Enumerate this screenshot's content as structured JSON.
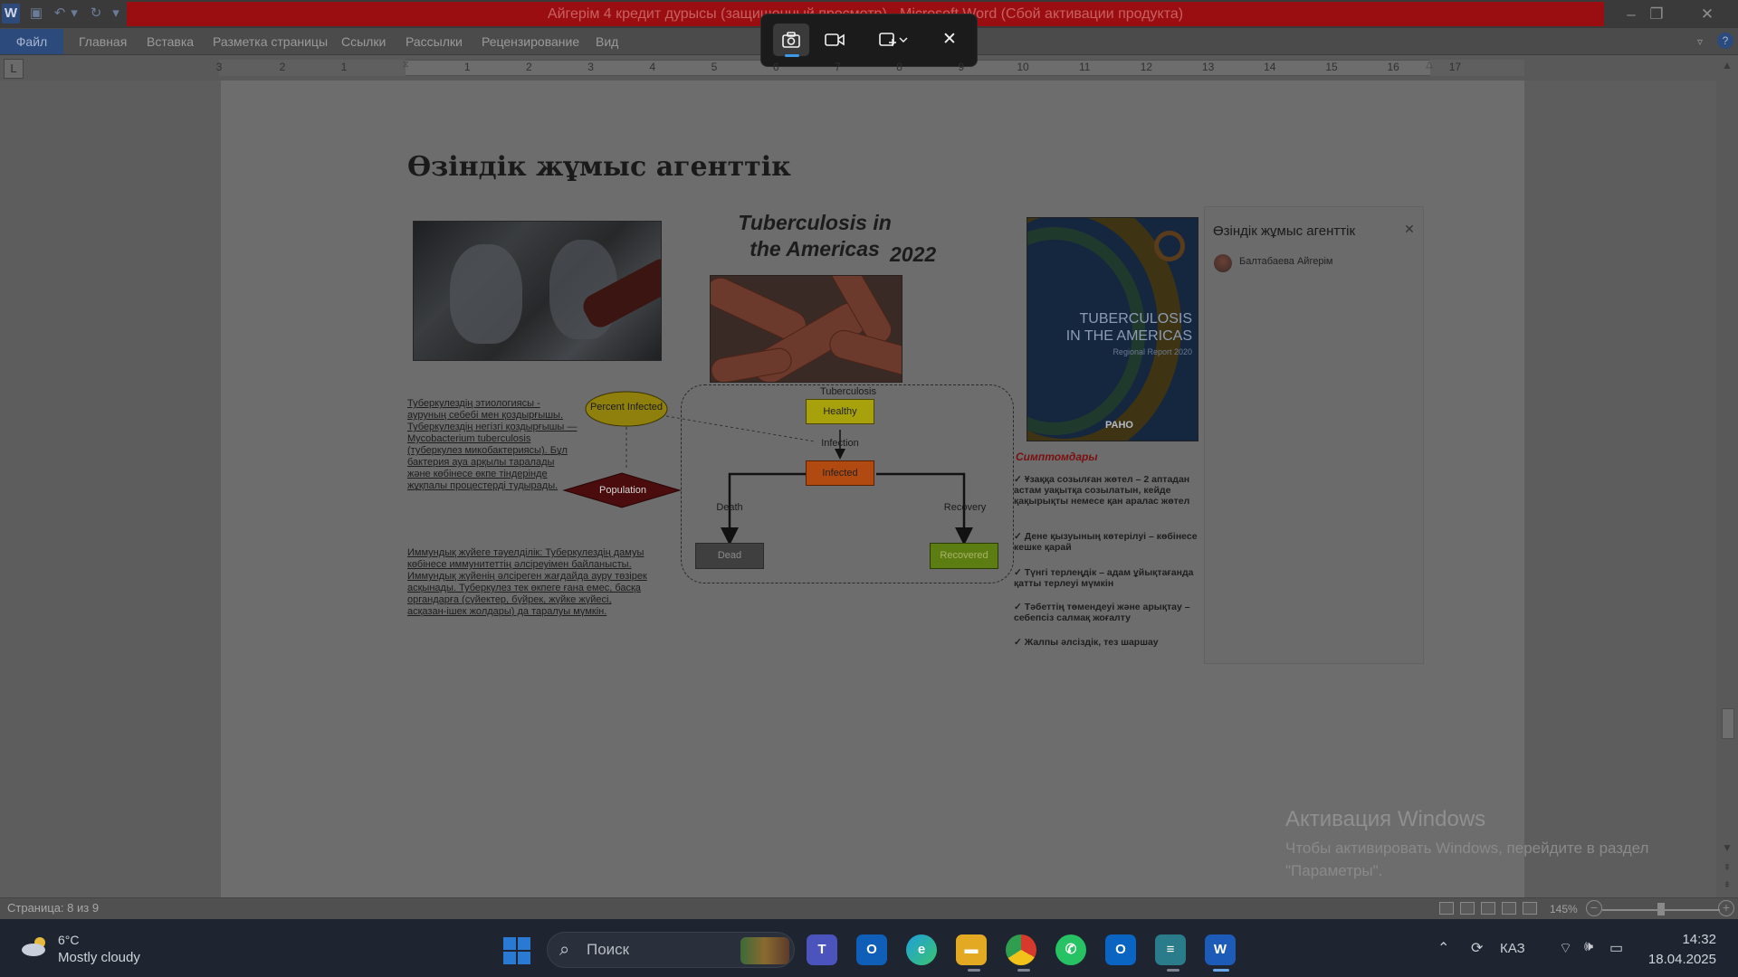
{
  "window": {
    "title": "Айгерім 4 кредит дурысы (защищенный просмотр) - Microsoft Word (Сбой активации продукта)",
    "app_icon": "W"
  },
  "ribbon": {
    "tabs": [
      "Файл",
      "Главная",
      "Вставка",
      "Разметка страницы",
      "Ссылки",
      "Рассылки",
      "Рецензирование",
      "Вид"
    ]
  },
  "ruler": {
    "left_numbers": [
      "3",
      "2",
      "1"
    ],
    "right_numbers": [
      "1",
      "2",
      "3",
      "4",
      "5",
      "6",
      "7",
      "8",
      "9",
      "10",
      "11",
      "12",
      "13",
      "14",
      "15",
      "16",
      "17"
    ]
  },
  "document": {
    "title": "Өзіндік жұмыс агенттік",
    "tb_title": "Tuberculosis in the Americas",
    "tb_year": "2022",
    "report_cover": {
      "title_line1": "TUBERCULOSIS",
      "title_line2": "IN THE AMERICAS",
      "subtitle": "Regional Report 2020",
      "logo": "PAHO"
    },
    "etiology_paragraph": "Туберкулездің этиологиясы - ауруның себебі мен қоздырғышы. Туберкулездің негізгі қоздырғышы — Mycobacterium tuberculosis (туберкулез микобактериясы). Бұл бактерия ауа арқылы таралады және көбінесе өкпе тіндерінде жұқпалы процестерді тудырады.",
    "immunity_paragraph": "Иммундық жүйеге тәуелділік: Туберкулездің дамуы көбінесе иммунитеттің әлсіреуімен байланысты. Иммундық жүйенің әлсіреген жағдайда ауру төзірек асқынады. Туберкулез тек өкпеге ғана емес, басқа органдарға (сүйектер, бүйрек, жүйке жүйесі, асқазан-ішек жолдары) да таралуы мүмкін.",
    "diagram": {
      "percent_infected": "Percent Infected",
      "population": "Population",
      "tuberculosis": "Tuberculosis",
      "healthy": "Healthy",
      "infection": "Infection",
      "infected": "Infected",
      "death": "Death",
      "recovery": "Recovery",
      "dead": "Dead",
      "recovered": "Recovered"
    },
    "symptoms": {
      "title": "Симптомдары",
      "items": [
        "✓ Ұзаққа созылған жөтел – 2 аптадан астам уақытқа созылатын, кейде қақырықты немесе қан аралас жөтел",
        "✓ Дене қызуының көтерілуі – көбінесе кешке қарай",
        "✓ Түнгі терлеңдік – адам ұйықтағанда қатты терлеуі мүмкін",
        "✓ Тәбеттің төмендеуі және арықтау – себепсіз салмақ жоғалту",
        "✓ Жалпы әлсіздік, тез шаршау"
      ]
    }
  },
  "side_pane": {
    "title": "Өзіндік жұмыс агенттік",
    "user": "Балтабаева Айгерім"
  },
  "capture_toolbar": {
    "buttons": [
      "camera-icon",
      "video-icon",
      "snip-mode-icon",
      "close-icon"
    ]
  },
  "watermark": {
    "title": "Активация Windows",
    "subtitle": "Чтобы активировать Windows, перейдите в раздел \"Параметры\"."
  },
  "status": {
    "page": "Страница: 8 из 9",
    "zoom": "145%",
    "zoom_level_fraction": 0.5
  },
  "taskbar": {
    "weather_temp": "6°C",
    "weather_desc": "Mostly cloudy",
    "search_placeholder": "Поиск",
    "language": "КАЗ",
    "time": "14:32",
    "date": "18.04.2025"
  },
  "colors": {
    "title_bar_alert": "#9a0e12",
    "file_tab": "#2d4a7c",
    "healthy": "#a7a20b",
    "infected": "#b04a10",
    "recovered": "#5c7d12",
    "dead": "#3f3f3f",
    "population": "#4a0c0c",
    "percent_infected": "#8f7f0c",
    "capture_accent": "#3d9ae8"
  }
}
